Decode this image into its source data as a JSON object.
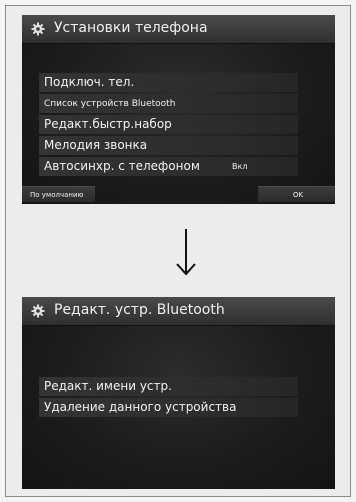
{
  "screen1": {
    "title": "Установки телефона",
    "title_icon": "gear-icon",
    "menu": [
      {
        "label": "Подключ. тел."
      },
      {
        "label": "Список устройств Bluetooth"
      },
      {
        "label": "Редакт.быстр.набор"
      },
      {
        "label": "Мелодия звонка"
      },
      {
        "label": "Автосинхр. с телефоном",
        "value": "Вкл"
      }
    ],
    "default_button": "По умолчанию",
    "ok_button": "OK"
  },
  "arrow_icon": "arrow-down-icon",
  "screen2": {
    "title": "Редакт. устр. Bluetooth",
    "title_icon": "gear-icon",
    "menu": [
      {
        "label": "Редакт. имени устр."
      },
      {
        "label": "Удаление данного устройства"
      }
    ]
  }
}
